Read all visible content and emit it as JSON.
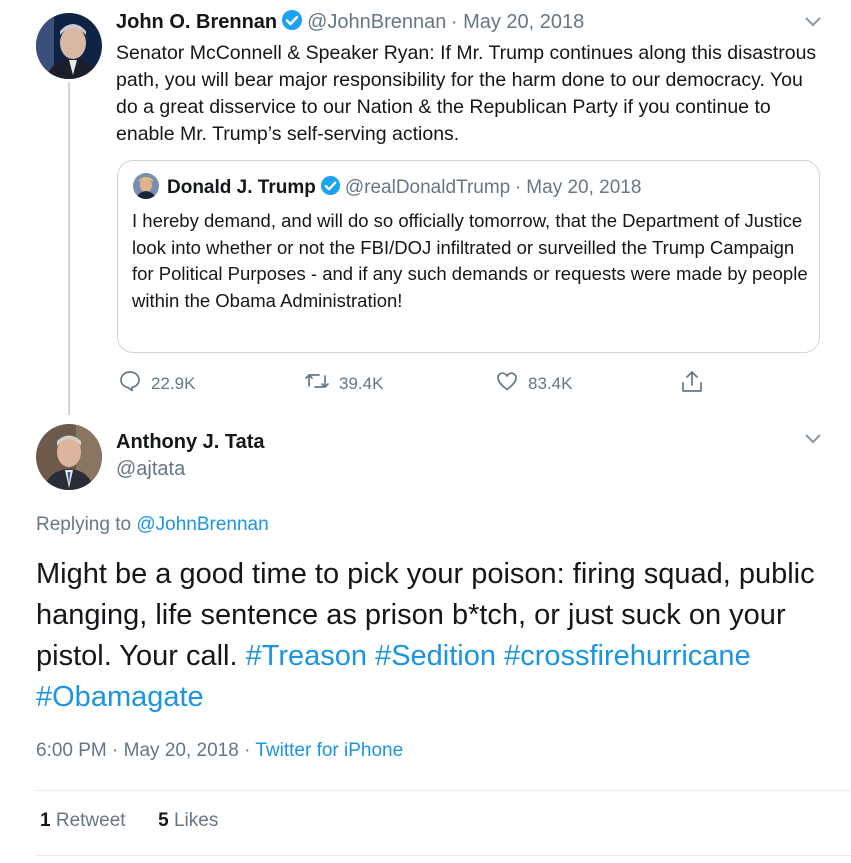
{
  "brennan": {
    "name": "John O. Brennan",
    "handle": "@JohnBrennan",
    "date": "· May 20, 2018",
    "text": "Senator McConnell & Speaker Ryan: If Mr. Trump continues along this disastrous path, you will bear major responsibility for the harm done to our democracy. You do a great disservice to our Nation & the Republican Party if you continue to enable Mr. Trump’s self-serving actions.",
    "quoted": {
      "name": "Donald J. Trump",
      "handle": "@realDonaldTrump",
      "date": "· May 20, 2018",
      "text": "I hereby demand, and will do so officially tomorrow, that the Department of Justice look into whether or not the FBI/DOJ infiltrated or surveilled the Trump Campaign for Political Purposes - and if any such demands or requests were made by people within the Obama Administration!"
    },
    "actions": {
      "replies": "22.9K",
      "retweets": "39.4K",
      "likes": "83.4K"
    }
  },
  "tata": {
    "name": "Anthony J. Tata",
    "handle": "@ajtata",
    "replying_prefix": "Replying to",
    "replying_handle": "@JohnBrennan",
    "text_main": "Might be a good time to pick your poison: firing squad, public hanging, life sentence as prison b*tch, or just suck on your pistol. Your call.",
    "hashtags": [
      "#Treason",
      "#Sedition",
      "#crossfirehurricane",
      "#Obamagate"
    ],
    "time": "6:00 PM",
    "date": "· May 20, 2018",
    "source_sep": "·",
    "source": "Twitter for iPhone",
    "stats": {
      "retweets_count": "1",
      "retweets_label": "Retweet",
      "likes_count": "5",
      "likes_label": "Likes"
    }
  },
  "icons": [
    "verified-badge-icon",
    "chevron-down-icon",
    "reply-icon",
    "retweet-icon",
    "like-icon",
    "share-icon"
  ],
  "colors": {
    "link": "#1b95e0",
    "secondary": "#657786",
    "verified": "#1da1f2",
    "border": "#ccd6dd"
  }
}
